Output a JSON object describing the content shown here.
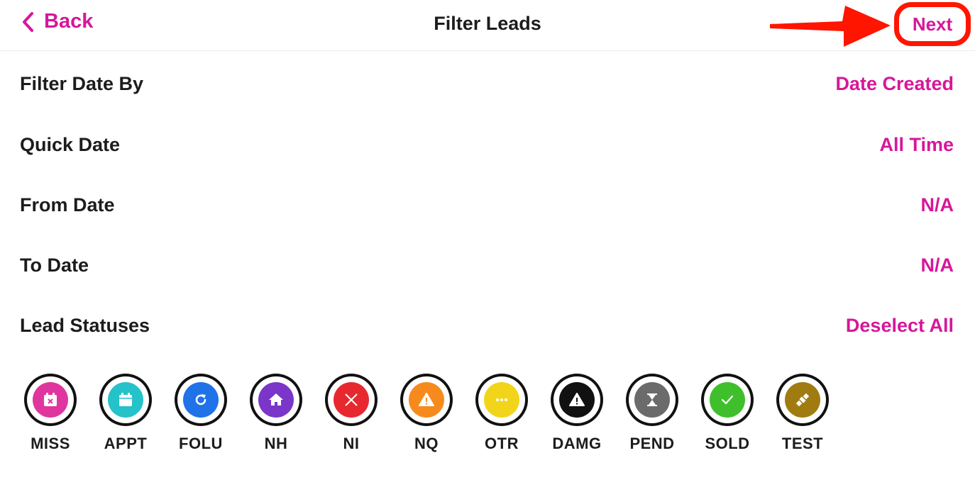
{
  "nav": {
    "back_label": "Back",
    "title": "Filter Leads",
    "next_label": "Next"
  },
  "filters": [
    {
      "label": "Filter Date By",
      "value": "Date Created"
    },
    {
      "label": "Quick Date",
      "value": "All Time"
    },
    {
      "label": "From Date",
      "value": "N/A"
    },
    {
      "label": "To Date",
      "value": "N/A"
    },
    {
      "label": "Lead Statuses",
      "value": "Deselect All"
    }
  ],
  "statuses": [
    {
      "code": "MISS",
      "color": "#e0359f",
      "icon": "calendar-x-icon"
    },
    {
      "code": "APPT",
      "color": "#25c2c9",
      "icon": "calendar-icon"
    },
    {
      "code": "FOLU",
      "color": "#1f72e8",
      "icon": "refresh-icon"
    },
    {
      "code": "NH",
      "color": "#7b35c9",
      "icon": "home-icon"
    },
    {
      "code": "NI",
      "color": "#e8282f",
      "icon": "x-icon"
    },
    {
      "code": "NQ",
      "color": "#f78a1d",
      "icon": "warning-icon"
    },
    {
      "code": "OTR",
      "color": "#f2d51a",
      "icon": "ellipsis-icon"
    },
    {
      "code": "DAMG",
      "color": "#111111",
      "icon": "warning-icon"
    },
    {
      "code": "PEND",
      "color": "#6b6b6b",
      "icon": "hourglass-icon"
    },
    {
      "code": "SOLD",
      "color": "#3fbf2b",
      "icon": "check-icon"
    },
    {
      "code": "TEST",
      "color": "#a07b10",
      "icon": "satellite-icon"
    }
  ],
  "colors": {
    "accent": "#d6179a",
    "annotation": "#ff1500"
  }
}
